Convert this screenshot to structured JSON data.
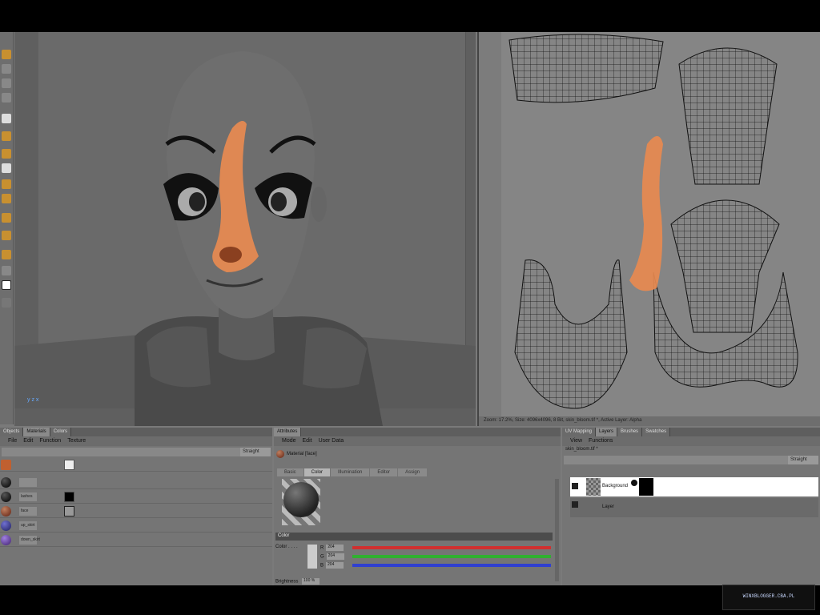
{
  "object_manager": {
    "tabs": [
      "Objects",
      "Materials",
      "Colors"
    ],
    "active_tab": "Materials",
    "menu": [
      "File",
      "Edit",
      "Function",
      "Texture"
    ],
    "mode": "Straight",
    "materials": [
      {
        "name": "",
        "color": "#1a1a1a"
      },
      {
        "name": "lashes",
        "color": "#222222"
      },
      {
        "name": "face",
        "color": "#b07050"
      },
      {
        "name": "up_skirt",
        "color": "#5050a0"
      },
      {
        "name": "down_skirt",
        "color": "#8060b0"
      }
    ]
  },
  "attributes": {
    "tab": "Attributes",
    "menu": [
      "Mode",
      "Edit",
      "User Data"
    ],
    "material_label": "Material [face]",
    "subtabs": [
      "Basic",
      "Color",
      "Illumination",
      "Editor",
      "Assign"
    ],
    "active_subtab": "Color",
    "section": "Color",
    "color_label": "Color . . . .",
    "channels": [
      {
        "label": "R",
        "value": "204",
        "color": "#d03030"
      },
      {
        "label": "G",
        "value": "204",
        "color": "#30b030"
      },
      {
        "label": "B",
        "value": "204",
        "color": "#3040d0"
      }
    ],
    "brightness_label": "Brightness",
    "brightness_value": "100 %"
  },
  "layers": {
    "tabs": [
      "UV Mapping",
      "Layers",
      "Brushes",
      "Swatches"
    ],
    "active_tab": "Layers",
    "menu": [
      "View",
      "Functions"
    ],
    "file": "skin_bloom.tif *",
    "mode": "Straight",
    "rows": [
      {
        "name": "Background"
      },
      {
        "name": "Layer"
      }
    ]
  },
  "uv": {
    "status": "Zoom: 17.2%, Size: 4096x4096, 8 Bit, skin_bloom.tif *, Active Layer: Alpha"
  },
  "viewport": {
    "axes": "y z x"
  },
  "watermark": "WINXBLOGGER.CBA.PL"
}
